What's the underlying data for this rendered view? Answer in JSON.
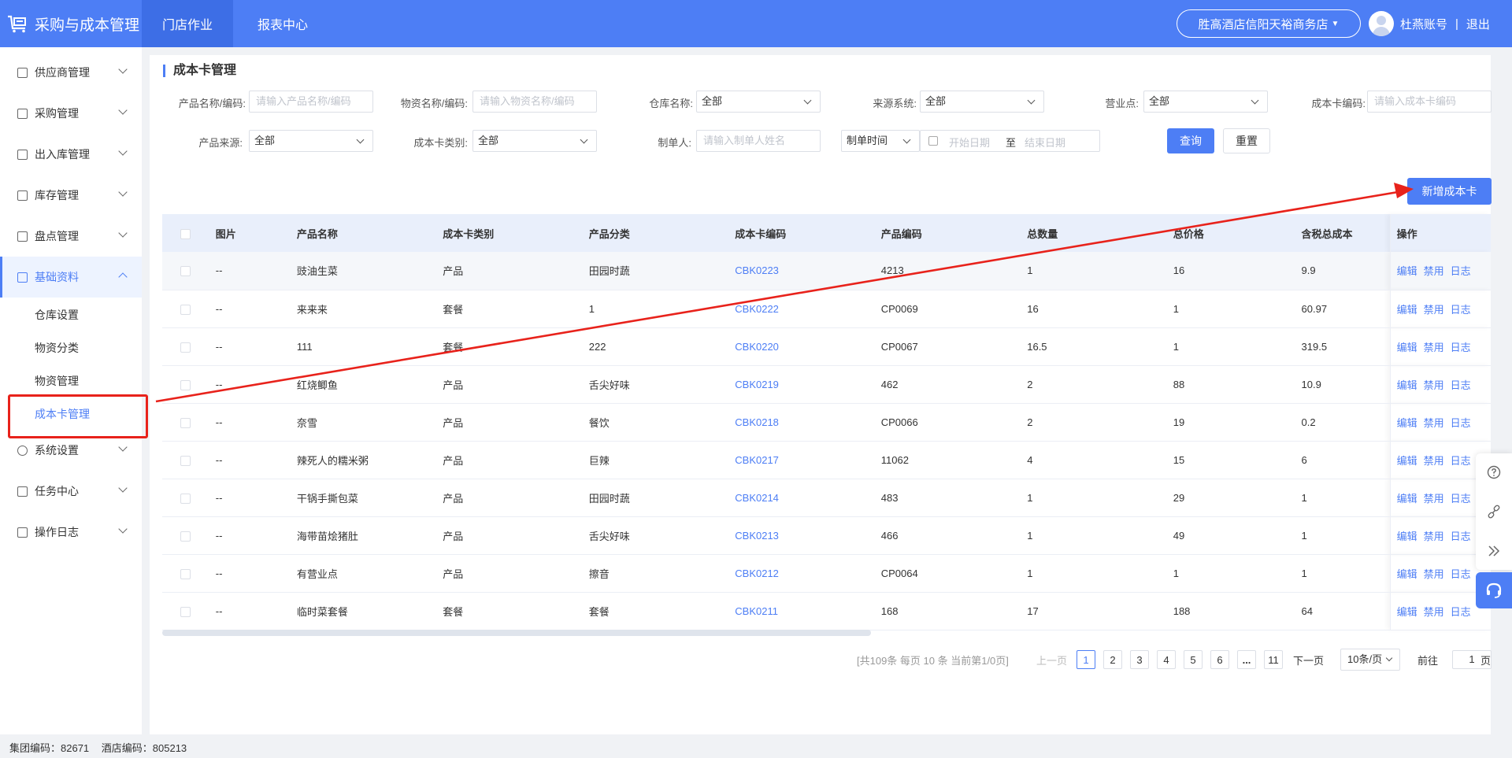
{
  "header": {
    "app_title": "采购与成本管理",
    "tabs": [
      {
        "label": "门店作业",
        "active": true
      },
      {
        "label": "报表中心",
        "active": false
      }
    ],
    "store": "胜高酒店信阳天裕商务店",
    "user_name": "杜燕账号",
    "separator": "|",
    "logout": "退出"
  },
  "sidebar": {
    "items": [
      {
        "label": "供应商管理",
        "icon": "supplier-icon"
      },
      {
        "label": "采购管理",
        "icon": "cart-icon"
      },
      {
        "label": "出入库管理",
        "icon": "inout-icon"
      },
      {
        "label": "库存管理",
        "icon": "inventory-icon"
      },
      {
        "label": "盘点管理",
        "icon": "stocktake-icon"
      },
      {
        "label": "基础资料",
        "icon": "basic-data-icon",
        "open": true
      },
      {
        "label": "系统设置",
        "icon": "gear-icon"
      },
      {
        "label": "任务中心",
        "icon": "task-icon"
      },
      {
        "label": "操作日志",
        "icon": "log-icon"
      }
    ],
    "sub_items": [
      {
        "label": "仓库设置"
      },
      {
        "label": "物资分类"
      },
      {
        "label": "物资管理"
      },
      {
        "label": "成本卡管理",
        "active": true
      }
    ]
  },
  "page": {
    "title": "成本卡管理"
  },
  "filters": {
    "product_name_label": "产品名称/编码:",
    "product_name_placeholder": "请输入产品名称/编码",
    "material_name_label": "物资名称/编码:",
    "material_name_placeholder": "请输入物资名称/编码",
    "warehouse_label": "仓库名称:",
    "warehouse_value": "全部",
    "source_system_label": "来源系统:",
    "source_system_value": "全部",
    "business_point_label": "营业点:",
    "business_point_value": "全部",
    "card_code_label": "成本卡编码:",
    "card_code_placeholder": "请输入成本卡编码",
    "product_source_label": "产品来源:",
    "product_source_value": "全部",
    "card_type_label": "成本卡类别:",
    "card_type_value": "全部",
    "creator_label": "制单人:",
    "creator_placeholder": "请输入制单人姓名",
    "date_type_value": "制单时间",
    "date_start_placeholder": "开始日期",
    "date_to": "至",
    "date_end_placeholder": "结束日期",
    "query_button": "查询",
    "reset_button": "重置"
  },
  "toolbar": {
    "add_button": "新增成本卡"
  },
  "table": {
    "headers": [
      "图片",
      "产品名称",
      "成本卡类别",
      "产品分类",
      "成本卡编码",
      "产品编码",
      "总数量",
      "总价格",
      "含税总成本",
      "操作"
    ],
    "ops": [
      "编辑",
      "禁用",
      "日志"
    ],
    "rows": [
      {
        "img": "--",
        "name": "豉油生菜",
        "type": "产品",
        "category": "田园时蔬",
        "code": "CBK0223",
        "product_code": "4213",
        "qty": "1",
        "price": "16",
        "cost": "9.9"
      },
      {
        "img": "--",
        "name": "来来来",
        "type": "套餐",
        "category": "1",
        "code": "CBK0222",
        "product_code": "CP0069",
        "qty": "16",
        "price": "1",
        "cost": "60.97"
      },
      {
        "img": "--",
        "name": "111",
        "type": "套餐",
        "category": "222",
        "code": "CBK0220",
        "product_code": "CP0067",
        "qty": "16.5",
        "price": "1",
        "cost": "319.5"
      },
      {
        "img": "--",
        "name": "红烧鲫鱼",
        "type": "产品",
        "category": "舌尖好味",
        "code": "CBK0219",
        "product_code": "462",
        "qty": "2",
        "price": "88",
        "cost": "10.9"
      },
      {
        "img": "--",
        "name": "奈雪",
        "type": "产品",
        "category": "餐饮",
        "code": "CBK0218",
        "product_code": "CP0066",
        "qty": "2",
        "price": "19",
        "cost": "0.2"
      },
      {
        "img": "--",
        "name": "辣死人的糯米粥",
        "type": "产品",
        "category": "巨辣",
        "code": "CBK0217",
        "product_code": "11062",
        "qty": "4",
        "price": "15",
        "cost": "6"
      },
      {
        "img": "--",
        "name": "干锅手撕包菜",
        "type": "产品",
        "category": "田园时蔬",
        "code": "CBK0214",
        "product_code": "483",
        "qty": "1",
        "price": "29",
        "cost": "1"
      },
      {
        "img": "--",
        "name": "海带苗烩猪肚",
        "type": "产品",
        "category": "舌尖好味",
        "code": "CBK0213",
        "product_code": "466",
        "qty": "1",
        "price": "49",
        "cost": "1"
      },
      {
        "img": "--",
        "name": "有营业点",
        "type": "产品",
        "category": "擦音",
        "code": "CBK0212",
        "product_code": "CP0064",
        "qty": "1",
        "price": "1",
        "cost": "1"
      },
      {
        "img": "--",
        "name": "临时菜套餐",
        "type": "套餐",
        "category": "套餐",
        "code": "CBK0211",
        "product_code": "168",
        "qty": "17",
        "price": "188",
        "cost": "64"
      }
    ]
  },
  "pagination": {
    "info": "[共109条 每页 10 条 当前第1/0页]",
    "prev": "上一页",
    "pages": [
      "1",
      "2",
      "3",
      "4",
      "5",
      "6",
      "...",
      "11"
    ],
    "current": "1",
    "next": "下一页",
    "page_size": "10条/页",
    "goto_label": "前往",
    "goto_value": "1",
    "goto_unit": "页"
  },
  "float_tools": [
    "help-icon",
    "link-icon",
    "collapse-icon",
    "support-icon"
  ],
  "footer": {
    "group_code": "集团编码：82671",
    "hotel_code": "酒店编码：805213"
  },
  "annotation": {
    "color": "#e8221b"
  }
}
